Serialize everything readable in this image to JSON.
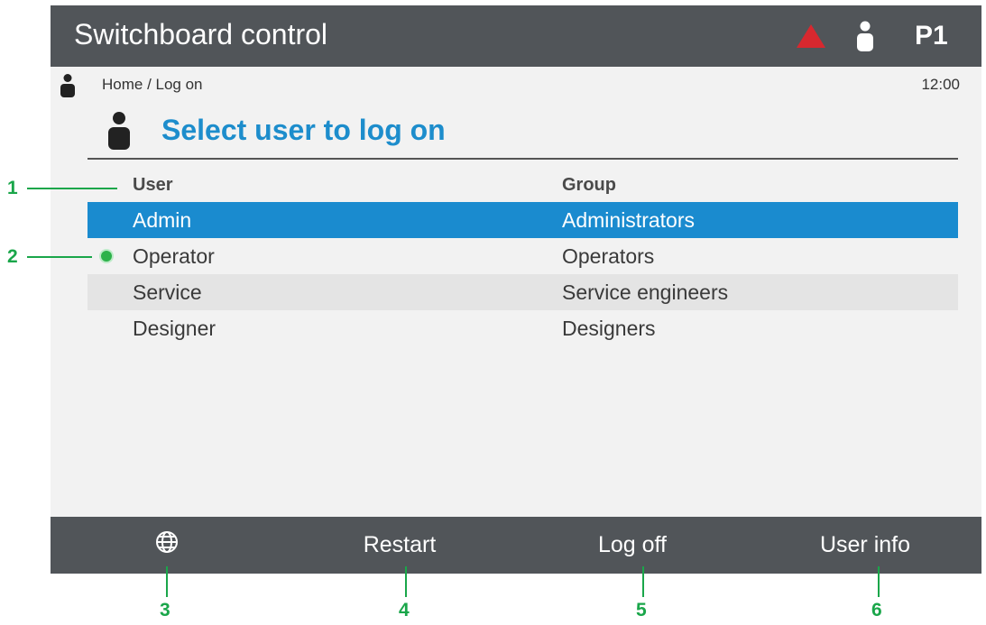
{
  "titlebar": {
    "title": "Switchboard control",
    "page": "P1",
    "alarm_icon": "alarm-triangle-icon",
    "user_icon": "user-icon",
    "alarm_color": "#d7282f",
    "background": "#515559"
  },
  "breadcrumb": {
    "path": "Home / Log on",
    "time": "12:00"
  },
  "page": {
    "heading": "Select user to log on",
    "accent": "#1d8dcc"
  },
  "table": {
    "headers": [
      "User",
      "Group"
    ],
    "rows": [
      {
        "user": "Admin",
        "group": "Administrators",
        "state": "selected"
      },
      {
        "user": "Operator",
        "group": "Operators",
        "state": "logged-in"
      },
      {
        "user": "Service",
        "group": "Service engineers",
        "state": ""
      },
      {
        "user": "Designer",
        "group": "Designers",
        "state": ""
      }
    ],
    "selected_color": "#1a8bcf",
    "logged_in_color": "#2db24a"
  },
  "softkeys": [
    {
      "label": "",
      "icon": "globe-icon"
    },
    {
      "label": "Restart"
    },
    {
      "label": "Log off"
    },
    {
      "label": "User info"
    }
  ],
  "callouts": [
    "1",
    "2",
    "3",
    "4",
    "5",
    "6"
  ],
  "callout_color": "#1aa64a"
}
